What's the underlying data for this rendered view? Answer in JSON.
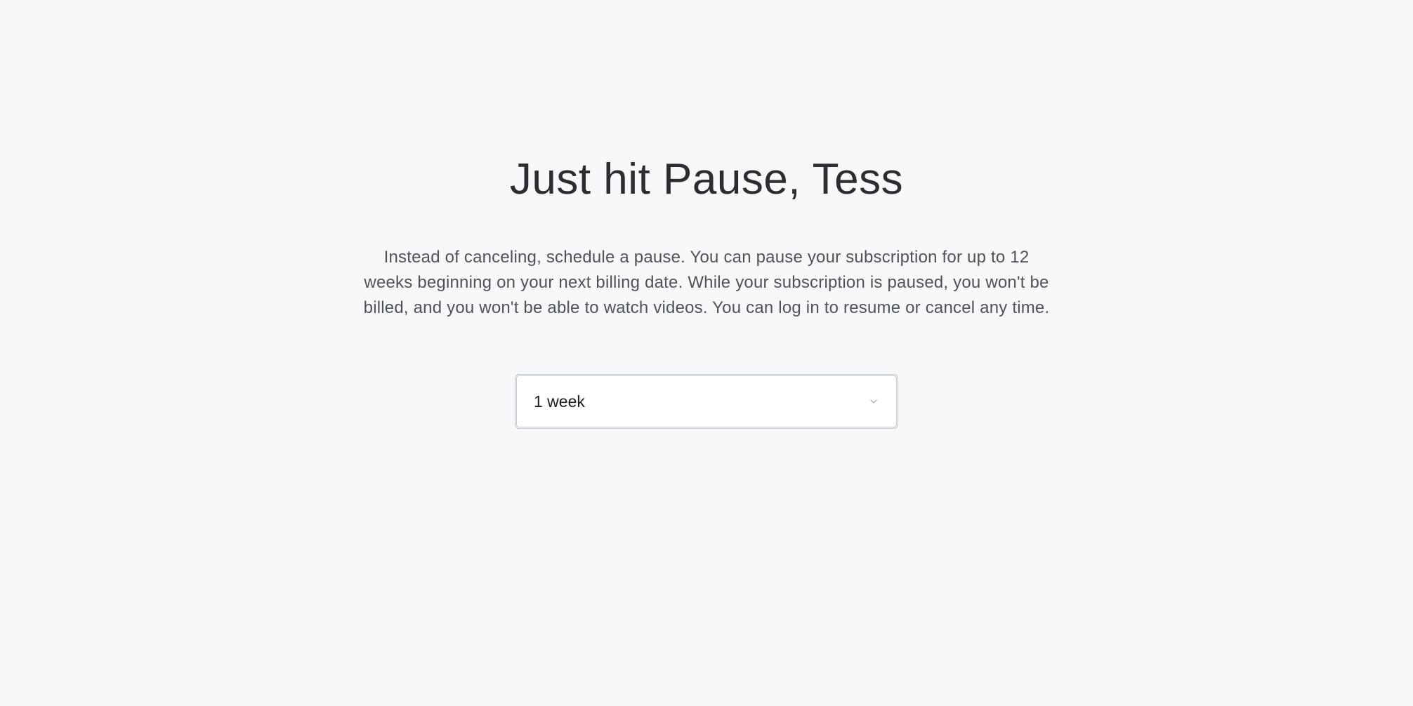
{
  "heading": "Just hit Pause, Tess",
  "description": "Instead of canceling, schedule a pause. You can pause your subscription for up to 12 weeks beginning on your next billing date. While your subscription is paused, you won't be billed, and you won't be able to watch videos. You can log in to resume or cancel any time.",
  "select": {
    "selected_value": "1 week"
  }
}
